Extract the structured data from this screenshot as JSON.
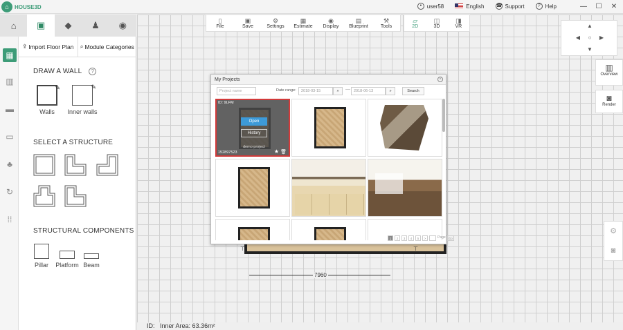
{
  "app": {
    "logo_text": "HOUSE3D"
  },
  "topbar": {
    "user": "user58",
    "language": "English",
    "support": "Support",
    "help": "Help"
  },
  "left_tabs": [
    "home-icon",
    "design-icon",
    "tag-icon",
    "user-icon",
    "search-icon"
  ],
  "panel": {
    "tab_import": "Import Floor Plan",
    "tab_modules": "Module Categories",
    "draw_wall_heading": "DRAW A WALL",
    "walls_label": "Walls",
    "inner_walls_label": "Inner walls",
    "structure_heading": "SELECT A STRUCTURE",
    "components_heading": "STRUCTURAL COMPONENTS",
    "pillar_label": "Pillar",
    "platform_label": "Platform",
    "beam_label": "Beam"
  },
  "toolbar": {
    "file": "File",
    "save": "Save",
    "settings": "Settings",
    "estimate": "Estimate",
    "display": "Display",
    "blueprint": "Blueprint",
    "tools": "Tools"
  },
  "view": {
    "v2d": "2D",
    "v3d": "3D",
    "vr": "VR"
  },
  "right": {
    "overview": "Overview",
    "render": "Render"
  },
  "canvas": {
    "dimension": "7960",
    "status_id": "ID:",
    "inner_area": "Inner Area: 63.36m²"
  },
  "modal": {
    "title": "My Projects",
    "project_name_placeholder": "Project name",
    "date_range_label": "Date range:",
    "date_from": "2018-03-15",
    "date_to": "2018-06-13",
    "search": "Search",
    "first_card": {
      "id": "ID: 9LFM",
      "open": "Open",
      "history": "History",
      "name": "demo project",
      "number": "152897523"
    },
    "pager": {
      "pages": [
        "1",
        "2",
        "3",
        "4",
        "5"
      ],
      "next": ">",
      "page_label": "Page",
      "go": "Go"
    }
  },
  "colors": {
    "accent": "#3d9c78",
    "highlight": "#d23a3a",
    "open_button": "#3d9ad8"
  }
}
